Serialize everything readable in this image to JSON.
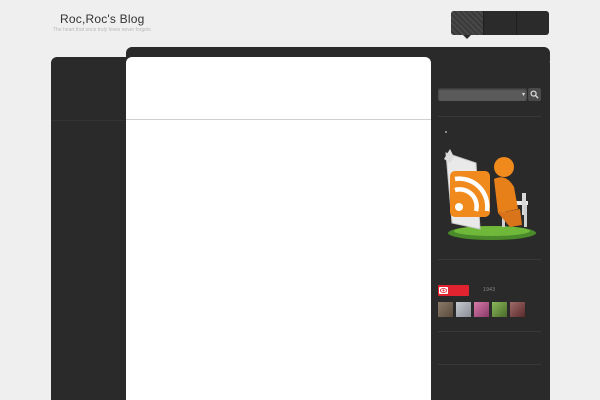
{
  "header": {
    "title": "Roc,Roc's Blog",
    "tagline": "The heart that once truly loves never forgets"
  },
  "nav": {
    "items": [
      {
        "name": "nav-item-1",
        "active": true
      },
      {
        "name": "nav-item-2",
        "active": false
      },
      {
        "name": "nav-item-3",
        "active": false
      }
    ]
  },
  "sidebar": {
    "search": {
      "value": "",
      "button_icon": "search-icon"
    },
    "rss_widget": {
      "icon": "rss-reader-icon"
    },
    "weibo": {
      "badge_icon": "weibo-eye-icon",
      "follower_count": "1943"
    },
    "followers": [
      {
        "name": "follower-avatar-1",
        "color": "#6b5a4a"
      },
      {
        "name": "follower-avatar-2",
        "color": "#9aa0a8"
      },
      {
        "name": "follower-avatar-3",
        "color": "#b75a8a"
      },
      {
        "name": "follower-avatar-4",
        "color": "#5f8a3a"
      },
      {
        "name": "follower-avatar-5",
        "color": "#7a4a4a"
      }
    ]
  },
  "colors": {
    "background": "#efefef",
    "panel": "#2a2a2a",
    "content": "#ffffff",
    "weibo_red": "#e0232e",
    "rss_orange": "#f08a1c"
  }
}
